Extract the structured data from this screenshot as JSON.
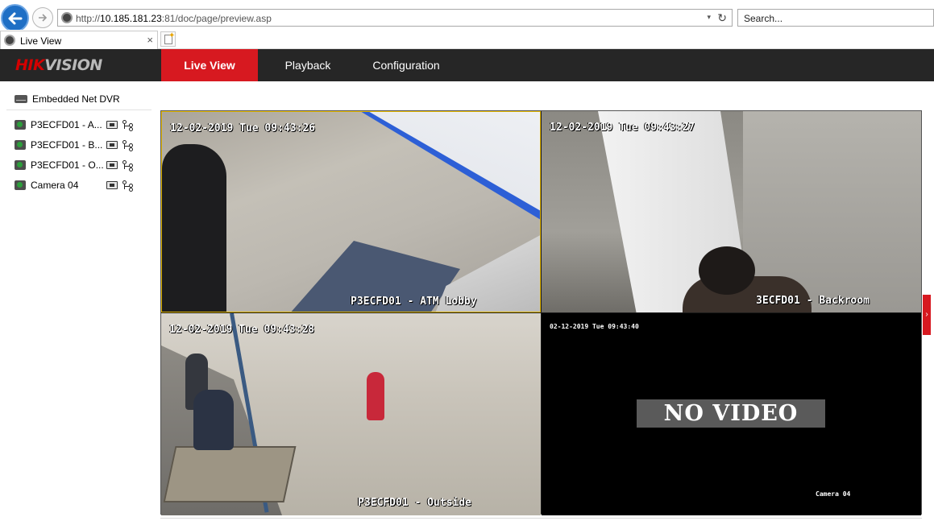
{
  "browser": {
    "url_prefix": "http://",
    "url_host": "10.185.181.23",
    "url_rest": ":81/doc/page/preview.asp",
    "search_placeholder": "Search...",
    "tab_title": "Live View",
    "tab_close": "×",
    "dropdown_glyph": "▾",
    "refresh_glyph": "↻"
  },
  "app": {
    "logo_red": "HIK",
    "logo_grey": "VISION",
    "nav": {
      "live": "Live View",
      "playback": "Playback",
      "config": "Configuration"
    },
    "accent_color": "#d71920"
  },
  "device_panel": {
    "root_label": "Embedded Net DVR",
    "cameras": [
      {
        "label": "P3ECFD01 - A..."
      },
      {
        "label": "P3ECFD01 - B..."
      },
      {
        "label": "P3ECFD01 - O..."
      },
      {
        "label": "Camera 04"
      }
    ]
  },
  "video": {
    "tiles": [
      {
        "timestamp": "12-02-2019 Tue 09:43:26",
        "name": "P3ECFD01 - ATM Lobby"
      },
      {
        "timestamp": "12-02-2019 Tue 09:43:27",
        "name": "3ECFD01 - Backroom"
      },
      {
        "timestamp": "12-02-2019 Tue 09:43:28",
        "name": "P3ECFD01 - Outside"
      },
      {
        "timestamp": "02-12-2019 Tue 09:43:40",
        "name": "Camera 04",
        "overlay": "NO VIDEO"
      }
    ]
  },
  "side_toggle_glyph": "›",
  "icons": [
    "back-arrow-icon",
    "forward-arrow-icon",
    "globe-icon",
    "refresh-icon",
    "dvr-icon",
    "camera-icon",
    "record-icon",
    "ptz-icon",
    "new-tab-icon",
    "close-icon"
  ]
}
